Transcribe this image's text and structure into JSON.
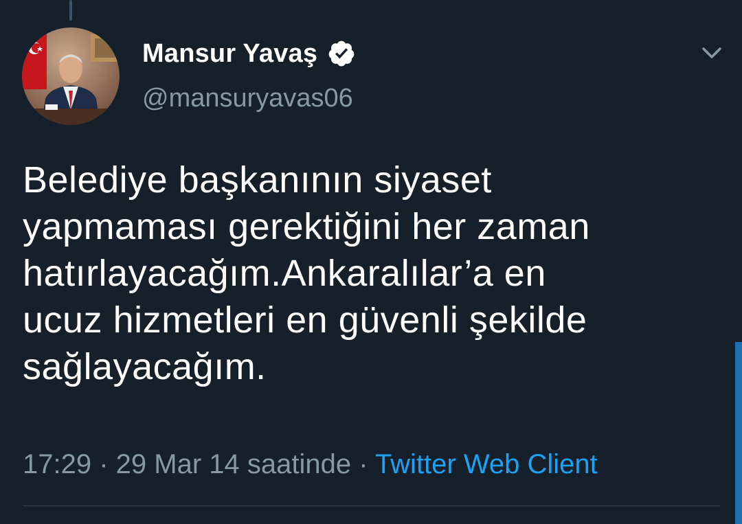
{
  "tweet": {
    "author": {
      "display_name": "Mansur Yavaş",
      "handle": "@mansuryavas06",
      "verified_icon": "verified-badge-icon",
      "avatar_icon": "profile-photo"
    },
    "menu_icon": "chevron-down-icon",
    "text_lines": [
      "Belediye başkanının siyaset",
      "yapmaması gerektiğini her zaman",
      "hatırlayacağım.Ankaralılar’a en",
      "ucuz hizmetleri en güvenli şekilde",
      "sağlayacağım."
    ],
    "time": "17:29",
    "separator": " · ",
    "date": "29 Mar 14 saatinde",
    "source": "Twitter Web Client"
  },
  "colors": {
    "background": "#15202b",
    "primary_text": "#ffffff",
    "secondary_text": "#8899a6",
    "link": "#1da1f2",
    "divider": "#38444d"
  }
}
